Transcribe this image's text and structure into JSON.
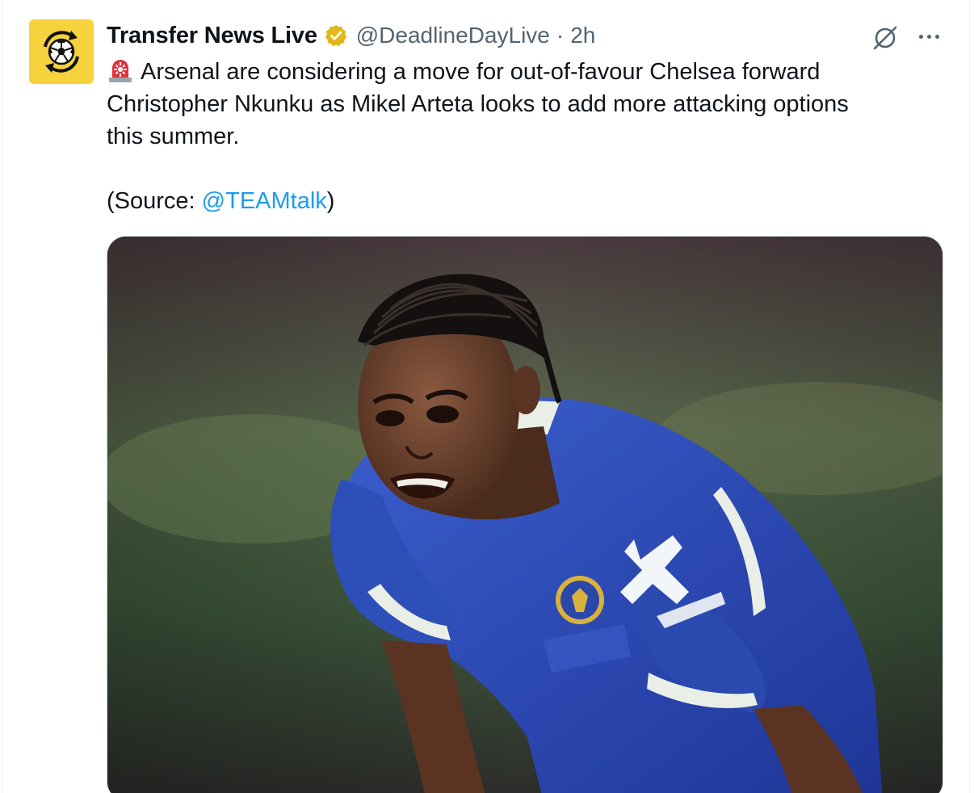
{
  "tweet": {
    "author": {
      "display_name": "Transfer News Live",
      "handle": "@DeadlineDayLive",
      "avatar_icon": "football-refresh-icon",
      "avatar_color": "#f6d33c",
      "verified_badge": "gold-verified-icon",
      "verified_color": "#e2b719"
    },
    "separator": "·",
    "time": "2h",
    "actions": {
      "grok_icon": "grok-icon",
      "more_icon": "more-icon"
    },
    "text": {
      "emoji": "siren-emoji",
      "line1": "Arsenal are considering a move for out-of-favour Chelsea forward",
      "line2": "Christopher Nkunku as Mikel Arteta looks to add more attacking options",
      "line3": "this summer.",
      "source_prefix": "(Source: ",
      "source_mention": "@TEAMtalk",
      "source_suffix": ")"
    },
    "media": {
      "kind": "photo",
      "accent_color": "#2f4fb8"
    }
  }
}
